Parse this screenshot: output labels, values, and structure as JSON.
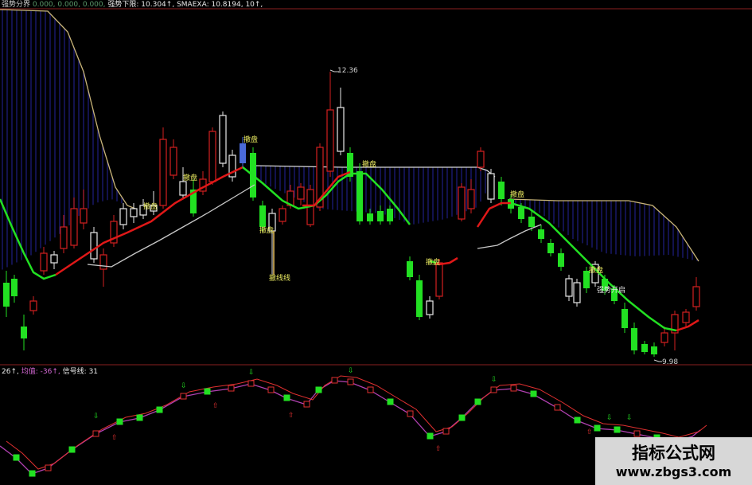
{
  "main_panel": {
    "indicators": [
      {
        "name": "强势分界",
        "value": "",
        "color": "#d0d0d0"
      },
      {
        "name": "",
        "value": "0.000, 0.000, 0.000,",
        "color": "#5a9a6a"
      },
      {
        "name": "强势下限:",
        "value": "10.304↑,",
        "color": "#e8e8e8"
      },
      {
        "name": "SMAEXA:",
        "value": "10.8194,",
        "color": "#e8e8e8"
      },
      {
        "name": "",
        "value": "10↑,",
        "color": "#e8e8e8"
      }
    ],
    "annotations": [
      {
        "id": "high",
        "text": "12.36",
        "color": "#d0d0d0"
      },
      {
        "id": "low",
        "text": "9.98",
        "color": "#d0d0d0"
      },
      {
        "id": "tag1",
        "text": "撤盘",
        "color": "#e8e860"
      },
      {
        "id": "tag2",
        "text": "撤盘",
        "color": "#e8e860"
      },
      {
        "id": "tag3",
        "text": "撤盘",
        "color": "#e8e860"
      },
      {
        "id": "tag4",
        "text": "撤盘",
        "color": "#e8e860"
      },
      {
        "id": "tag5",
        "text": "撤盘",
        "color": "#e8e860"
      },
      {
        "id": "tag6",
        "text": "撤盘",
        "color": "#e8e860"
      },
      {
        "id": "tag7",
        "text": "撤盘",
        "color": "#e8e860"
      },
      {
        "id": "tag8",
        "text": "撤盘",
        "color": "#e8e860"
      },
      {
        "id": "sell",
        "text": "撤线线",
        "color": "#e8e860"
      },
      {
        "id": "buy",
        "text": "强势开启",
        "color": "#e8e8e8"
      }
    ]
  },
  "sub_panel": {
    "indicators": [
      {
        "name": "",
        "value": "26↑,",
        "color": "#e8e8e8"
      },
      {
        "name": "均值:",
        "value": "-36↑,",
        "color": "#d86ad8"
      },
      {
        "name": "信号线:",
        "value": "31",
        "color": "#e8e8e8"
      }
    ]
  },
  "colors": {
    "up": "#d42020",
    "down": "#22e022",
    "ma_green": "#22e022",
    "ma_red": "#e01818",
    "stripe": "#1c1c78",
    "envelope": "#c8b478",
    "ma_white": "#c8c8c8",
    "osc_purple": "#b040b0",
    "osc_red": "#e03030",
    "divider": "#8a1f1f"
  },
  "watermark": {
    "title": "指标公式网",
    "url": "www.zbgs3.com"
  }
}
